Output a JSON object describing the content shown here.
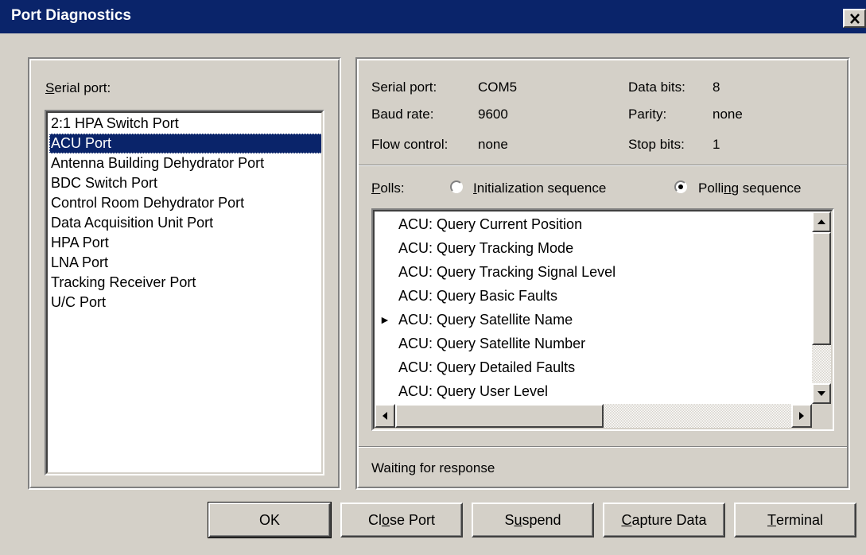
{
  "window": {
    "title": "Port Diagnostics",
    "close_label": "×"
  },
  "serial_port_panel": {
    "label_key": "S",
    "label_rest": "erial port:",
    "ports": [
      "2:1 HPA Switch Port",
      "ACU Port",
      "Antenna Building Dehydrator Port",
      "BDC Switch Port",
      "Control Room Dehydrator Port",
      "Data Acquisition Unit Port",
      "HPA Port",
      "LNA Port",
      "Tracking Receiver Port",
      "U/C Port"
    ],
    "selected_index": 1
  },
  "port_info": {
    "serial_port_label": "Serial port:",
    "serial_port_value": "COM5",
    "baud_rate_label": "Baud rate:",
    "baud_rate_value": "9600",
    "flow_control_label": "Flow control:",
    "flow_control_value": "none",
    "data_bits_label": "Data bits:",
    "data_bits_value": "8",
    "parity_label": "Parity:",
    "parity_value": "none",
    "stop_bits_label": "Stop bits:",
    "stop_bits_value": "1"
  },
  "polls": {
    "label_key": "P",
    "label_rest": "olls:",
    "init_key": "I",
    "init_rest": "nitialization sequence",
    "polling_pre": "Polli",
    "polling_key": "n",
    "polling_rest": "g sequence",
    "selected": "polling",
    "items": [
      "ACU: Query Current Position",
      "ACU: Query Tracking Mode",
      "ACU: Query Tracking Signal Level",
      "ACU: Query Basic Faults",
      "ACU: Query Satellite Name",
      "ACU: Query Satellite Number",
      "ACU: Query Detailed Faults",
      "ACU: Query User Level"
    ],
    "current_index": 4,
    "current_marker": "►"
  },
  "status": {
    "text": "Waiting for response"
  },
  "buttons": {
    "ok": "OK",
    "close_port_pre": "Cl",
    "close_port_key": "o",
    "close_port_rest": "se Port",
    "suspend_pre": "S",
    "suspend_key": "u",
    "suspend_rest": "spend",
    "capture_key": "C",
    "capture_rest": "apture Data",
    "terminal_key": "T",
    "terminal_rest": "erminal"
  }
}
